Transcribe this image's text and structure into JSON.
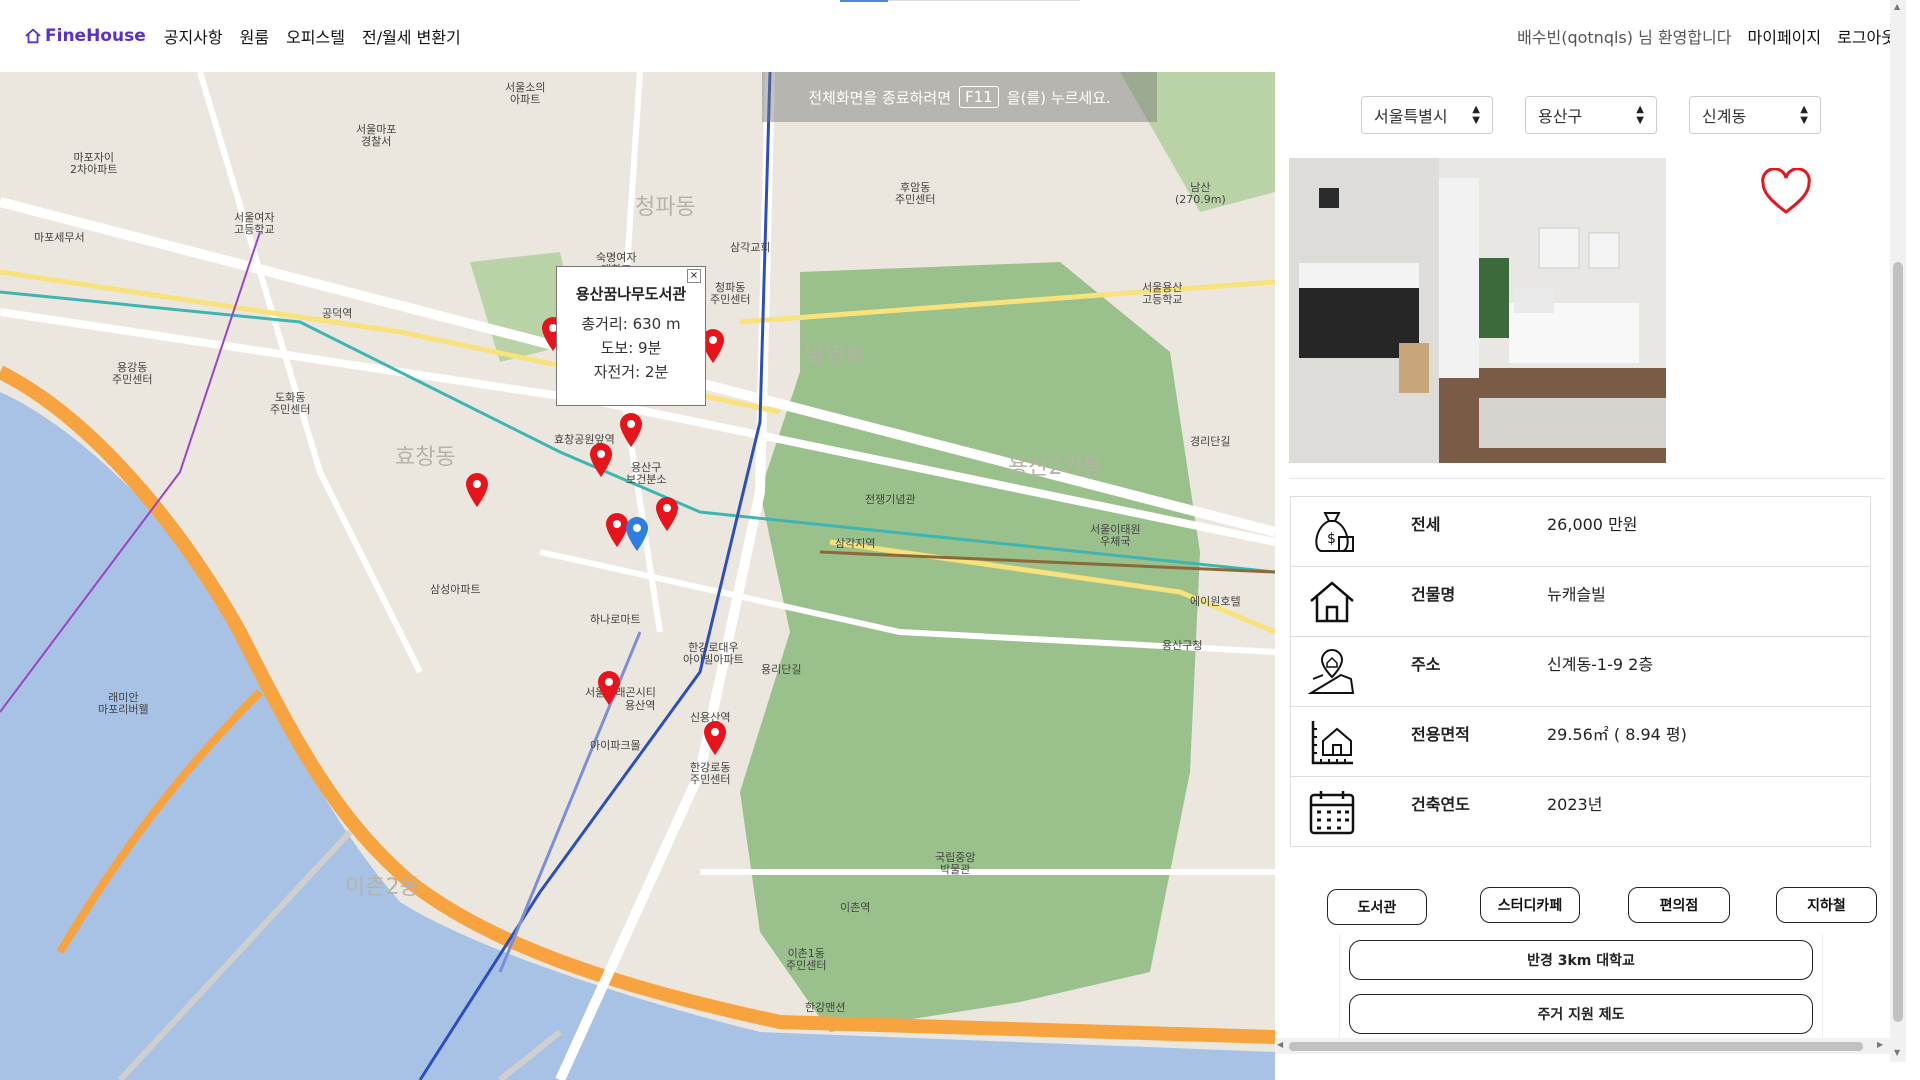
{
  "nav": {
    "brand": "FineHouse",
    "links": [
      "공지사항",
      "원룸",
      "오피스텔",
      "전/월세 변환기"
    ],
    "welcome": "배수빈(qotnqls) 님 환영합니다",
    "mypage": "마이페이지",
    "logout": "로그아웃"
  },
  "map": {
    "toast_prefix": "전체화면을 종료하려면",
    "toast_key": "F11",
    "toast_suffix": "을(를) 누르세요.",
    "popup": {
      "title": "용산꿈나무도서관",
      "distance": "총거리: 630 m",
      "walk": "도보: 9분",
      "bike": "자전거: 2분",
      "close": "×"
    },
    "labels": {
      "l1": "서울소의\n아파트",
      "l2": "서울마포\n경찰서",
      "l3": "마포자이\n2차아파트",
      "l4": "서울여자\n고등학교",
      "l5": "공덕역",
      "l6": "효창공원앞역",
      "l7": "용산구\n보건분소",
      "l8": "삼각지역",
      "l9": "용산역",
      "l10": "이촌역",
      "l11": "남영동",
      "l12": "용산2가동",
      "l13": "청파동",
      "l14": "효창동",
      "l15": "한강로동\n주민센터",
      "l16": "이촌2동",
      "l17": "국립중앙\n박물관",
      "l18": "전쟁기념관",
      "l19": "숙명여자\n대학교",
      "l20": "용산구청",
      "l21": "남산\n(270.9m)",
      "l22": "후암동\n주민센터",
      "l23": "삼각교회",
      "l24": "청파동\n주민센터",
      "l25": "서울용산\n고등학교",
      "l26": "이촌1동\n주민센터",
      "l27": "한강로대우\n아이빌아파트",
      "l28": "하나로마트",
      "l29": "용리단길",
      "l30": "경리단길",
      "l31": "서울이태원\n우체국",
      "l32": "에이원호텔",
      "l33": "마포세무서",
      "l34": "도화동\n주민센터",
      "l35": "용강동\n주민센터",
      "l36": "래미안\n마포리버웰",
      "l37": "삼성아파트",
      "l38": "한강맨션",
      "l39": "서울드래곤시티",
      "l40": "아이파크몰",
      "l41": "신용산역"
    }
  },
  "filters": {
    "city": "서울특별시",
    "district": "용산구",
    "dong": "신계동"
  },
  "details": [
    {
      "icon": "money-bag-icon",
      "label": "전세",
      "value": "26,000 만원"
    },
    {
      "icon": "house-icon",
      "label": "건물명",
      "value": "뉴캐슬빌"
    },
    {
      "icon": "location-map-icon",
      "label": "주소",
      "value": "신계동-1-9 2층"
    },
    {
      "icon": "building-area-icon",
      "label": "전용면적",
      "value": "29.56㎡ ( 8.94 평)"
    },
    {
      "icon": "calendar-icon",
      "label": "건축연도",
      "value": "2023년"
    }
  ],
  "facility_buttons": [
    "도서관",
    "스터디카페",
    "편의점",
    "지하철"
  ],
  "wide_buttons": [
    "반경 3km 대학교",
    "주거 지원 제도"
  ],
  "colors": {
    "brand": "#5b2fc9",
    "marker_red": "#e8141c",
    "marker_blue": "#2f7de1",
    "park_green": "#8cb87d",
    "river_blue": "#a8c2e6",
    "road_orange": "#f7a340"
  }
}
